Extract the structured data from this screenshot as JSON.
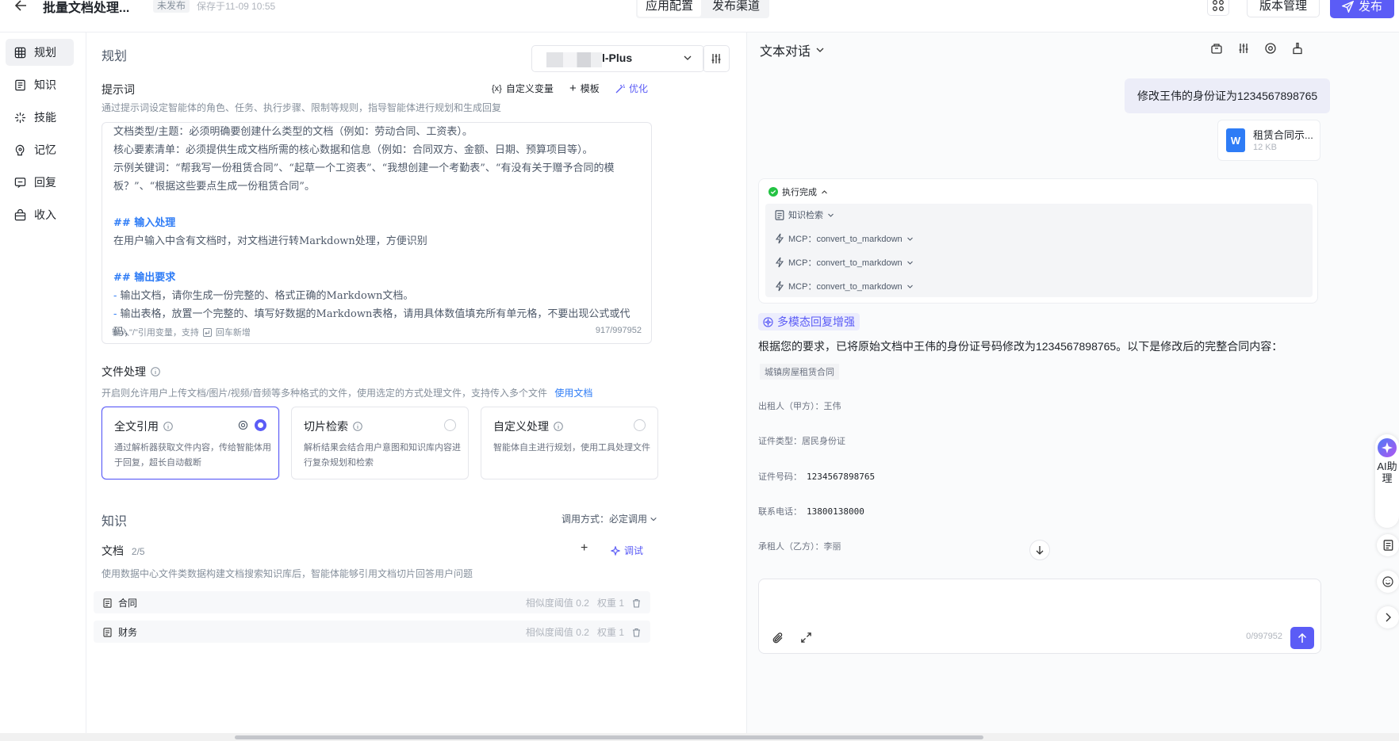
{
  "header": {
    "title": "批量文档处理...",
    "status_badge": "未发布",
    "saved_text": "保存于11-09 10:55",
    "tabs": [
      "应用配置",
      "发布渠道"
    ],
    "version_label": "版本管理",
    "publish_label": "发布"
  },
  "nav": {
    "items": [
      {
        "label": "规划",
        "icon": "grid-icon"
      },
      {
        "label": "知识",
        "icon": "book-icon"
      },
      {
        "label": "技能",
        "icon": "sparkle-icon"
      },
      {
        "label": "记忆",
        "icon": "brain-icon"
      },
      {
        "label": "回复",
        "icon": "reply-icon"
      },
      {
        "label": "收入",
        "icon": "bag-icon"
      }
    ]
  },
  "plan": {
    "section_title": "规划",
    "model_name": "l-Plus",
    "prompt": {
      "label": "提示词",
      "custom_var": "自定义变量",
      "template": "模板",
      "optimize": "优化",
      "hint": "通过提示词设定智能体的角色、任务、执行步骤、限制等规则，指导智能体进行规划和生成回复",
      "lines": [
        {
          "type": "p",
          "text": "文档类型/主题：必须明确要创建什么类型的文档（例如：劳动合同、工资表）。"
        },
        {
          "type": "p",
          "text": "核心要素清单：必须提供生成文档所需的核心数据和信息（例如：合同双方、金额、日期、预算项目等）。"
        },
        {
          "type": "p",
          "text": "示例关键词：“帮我写一份租赁合同”、“起草一个工资表”、“我想创建一个考勤表”、“有没有关于赠予合同的模"
        },
        {
          "type": "p",
          "text": "板？”、“根据这些要点生成一份租赁合同”。"
        },
        {
          "type": "blank",
          "text": ""
        },
        {
          "type": "h",
          "text": "## 输入处理"
        },
        {
          "type": "p",
          "text": "在用户输入中含有文档时，对文档进行转Markdown处理，方便识别"
        },
        {
          "type": "blank",
          "text": ""
        },
        {
          "type": "h",
          "text": "## 输出要求"
        },
        {
          "type": "li",
          "text": "输出文档，请你生成一份完整的、格式正确的Markdown文档。"
        },
        {
          "type": "li",
          "text": "输出表格，放置一个完整的、填写好数据的Markdown表格，请用具体数值填充所有单元格，不要出现公式或代码，"
        }
      ],
      "input_hint": "输入\"/\"引用变量，支持",
      "input_hint2": "回车新增",
      "count": "917/997952"
    },
    "file_processing": {
      "label": "文件处理",
      "hint": "开启则允许用户上传文档/图片/视频/音频等多种格式的文件，使用选定的方式处理文件，支持传入多个文件",
      "doc_link": "使用文档",
      "cards": [
        {
          "title": "全文引用",
          "desc": "通过解析器获取文件内容，传给智能体用于回复，超长自动截断",
          "selected": true
        },
        {
          "title": "切片检索",
          "desc": "解析结果会结合用户意图和知识库内容进行复杂规划和检索",
          "selected": false
        },
        {
          "title": "自定义处理",
          "desc": "智能体自主进行规划，使用工具处理文件",
          "selected": false
        }
      ]
    }
  },
  "knowledge": {
    "section_title": "知识",
    "call_mode": "调用方式：必定调用",
    "docs_label": "文档",
    "docs_count": "2/5",
    "debug_label": "调试",
    "hint": "使用数据中心文件类数据构建文档搜索知识库后，智能体能够引用文档切片回答用户问题",
    "rows": [
      {
        "name": "合同",
        "threshold_label": "相似度阈值",
        "threshold": "0.2",
        "weight_label": "权重",
        "weight": "1"
      },
      {
        "name": "财务",
        "threshold_label": "相似度阈值",
        "threshold": "0.2",
        "weight_label": "权重",
        "weight": "1"
      }
    ]
  },
  "chat": {
    "mode_title": "文本对话",
    "user_message": "修改王伟的身份证为1234567898765",
    "file": {
      "name": "租赁合同示...",
      "size": "12 KB"
    },
    "exec": {
      "status": "执行完成",
      "items": [
        {
          "icon": "document-icon",
          "label": "知识检索"
        },
        {
          "icon": "lightning-icon",
          "label": "MCP：convert_to_markdown"
        },
        {
          "icon": "lightning-icon",
          "label": "MCP：convert_to_markdown"
        },
        {
          "icon": "lightning-icon",
          "label": "MCP：convert_to_markdown"
        }
      ]
    },
    "enhance_tag": "多模态回复增强",
    "answer": "根据您的要求，已将原始文档中王伟的身份证号码修改为1234567898765。以下是修改后的完整合同内容：",
    "doc_lines": [
      {
        "label": "城镇房屋租赁合同",
        "value": ""
      },
      {
        "label": "出租人（甲方）：王伟",
        "value": ""
      },
      {
        "label": "证件类型：居民身份证",
        "value": ""
      },
      {
        "label": "证件号码：",
        "value": "1234567898765"
      },
      {
        "label": "联系电话：",
        "value": "13800138000"
      },
      {
        "label": "承租人（乙方）：李丽",
        "value": ""
      }
    ],
    "input_count": "0/997952",
    "ai_assistant": "AI助理"
  },
  "colors": {
    "accent": "#5b5cf6",
    "link": "#2e7cf6"
  }
}
